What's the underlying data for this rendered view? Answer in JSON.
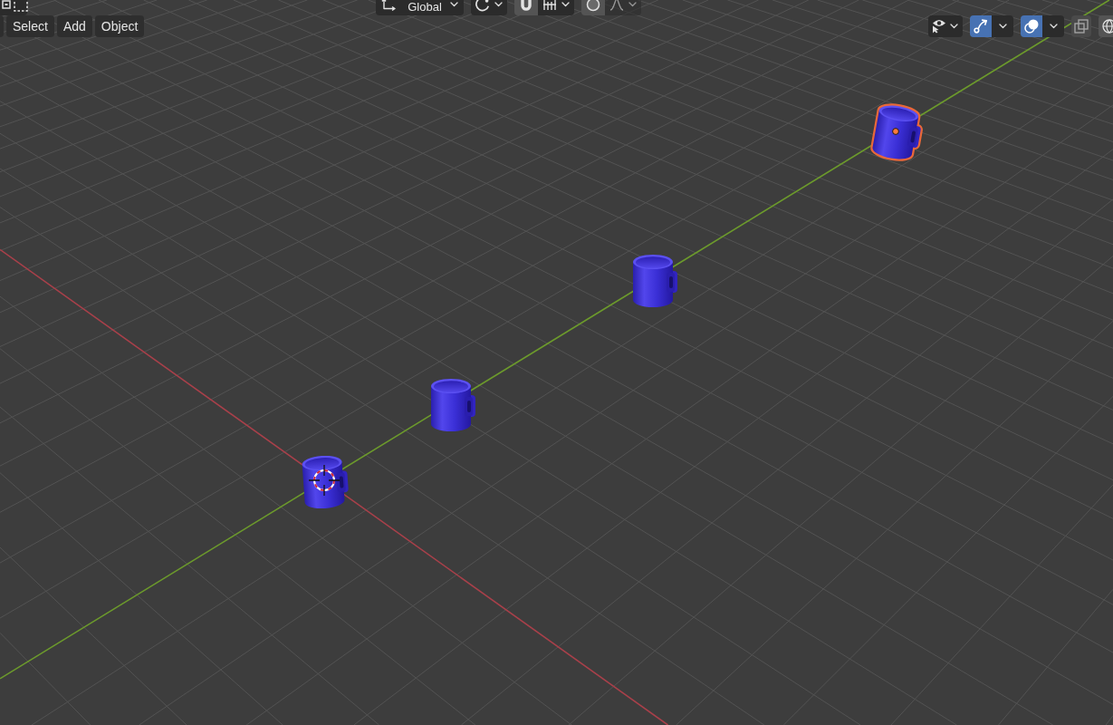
{
  "top_header": [
    {
      "kind": "select_mode"
    },
    {
      "kind": "orientation",
      "label": "Global"
    },
    {
      "kind": "pivot"
    },
    {
      "kind": "snap",
      "on": false
    },
    {
      "kind": "proportional",
      "on": false
    }
  ],
  "menu": [
    {
      "label": "Select"
    },
    {
      "label": "Add"
    },
    {
      "label": "Object"
    }
  ],
  "view_controls": [
    {
      "kind": "visibility"
    },
    {
      "kind": "gizmos",
      "on": true
    },
    {
      "kind": "overlays",
      "on": true
    },
    {
      "kind": "xray",
      "on": false
    },
    {
      "kind": "wireframe_shading",
      "selected": false
    }
  ],
  "objects": [
    {
      "selected": false
    },
    {
      "selected": false
    },
    {
      "selected": false
    },
    {
      "selected": true
    }
  ]
}
